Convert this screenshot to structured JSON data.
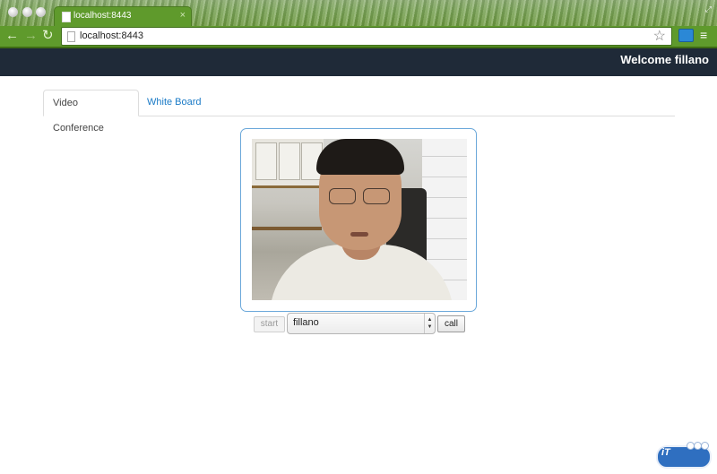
{
  "browser": {
    "tab_title": "localhost:8443",
    "tab_close": "×",
    "url": "localhost:8443",
    "back_icon": "←",
    "forward_icon": "→",
    "reload_icon": "↻",
    "star_icon": "☆",
    "menu_icon": "≡",
    "maximize_icon": "⤢"
  },
  "navbar": {
    "welcome": "Welcome fillano"
  },
  "tabs": [
    {
      "label": "Video Conference",
      "active": true
    },
    {
      "label": "White Board",
      "active": false
    }
  ],
  "controls": {
    "start_label": "start",
    "peer_selected": "fillano",
    "call_label": "call"
  },
  "colors": {
    "navbar_bg": "#1f2a38",
    "link": "#1a7ac6",
    "video_border": "#6ba8da"
  }
}
